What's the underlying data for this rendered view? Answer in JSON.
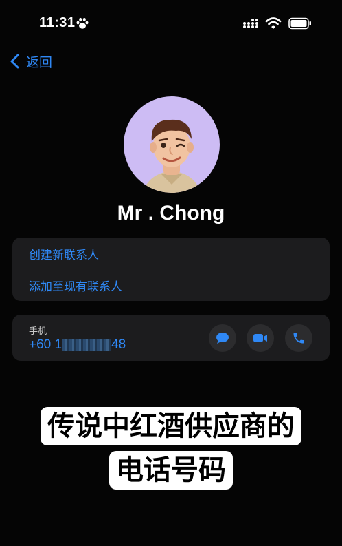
{
  "status_bar": {
    "time": "11:31",
    "icons": [
      "paw-icon",
      "cellular-signal-icon",
      "wifi-icon",
      "battery-icon"
    ]
  },
  "nav": {
    "back_label": "返回"
  },
  "contact": {
    "name": "Mr . Chong",
    "avatar": "memoji-avatar"
  },
  "actions": {
    "create_new": "创建新联系人",
    "add_existing": "添加至现有联系人"
  },
  "phone": {
    "label": "手机",
    "number_prefix": "+60 1",
    "number_suffix": "48",
    "buttons": [
      "message-icon",
      "video-icon",
      "phone-icon"
    ]
  },
  "caption": {
    "line1": "传说中红酒供应商的",
    "line2": "电话号码"
  },
  "colors": {
    "accent": "#2f88f5",
    "background": "#050505",
    "card": "#1c1c1e",
    "avatar_bg": "#cdbcf4"
  }
}
